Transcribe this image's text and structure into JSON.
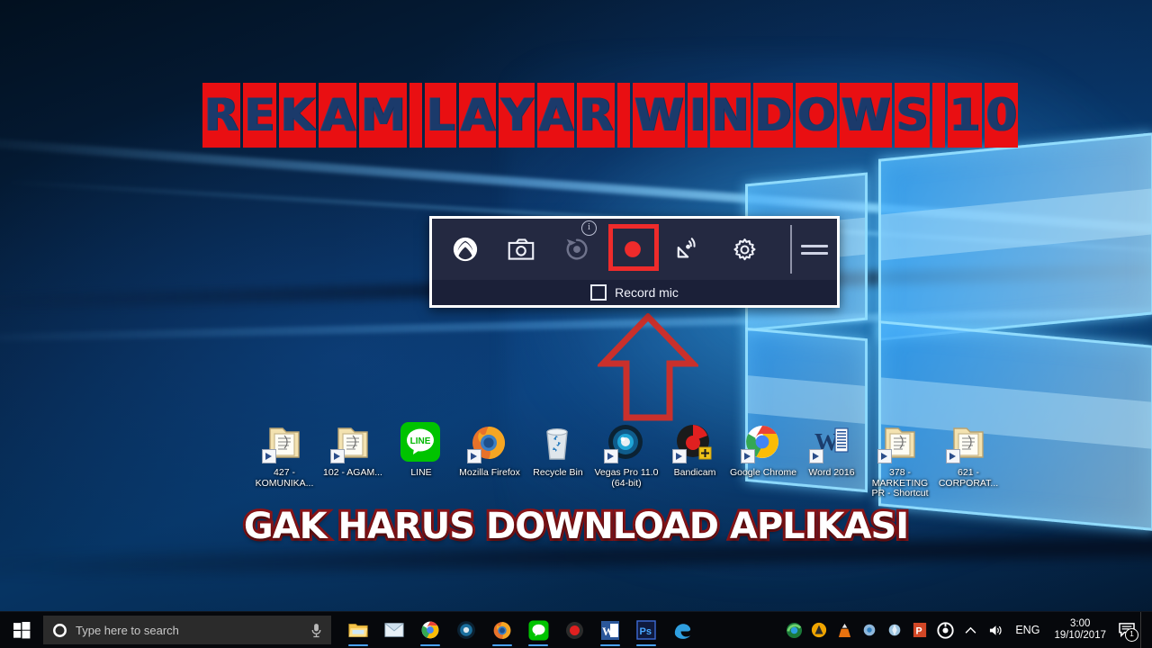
{
  "video_title": {
    "text": "REKAM LAYAR WINDOWS 10",
    "letters": [
      "R",
      "E",
      "K",
      "A",
      "M",
      " ",
      "L",
      "A",
      "Y",
      "A",
      "R",
      " ",
      "W",
      "I",
      "N",
      "D",
      "O",
      "W",
      "S",
      " ",
      "1",
      "0"
    ],
    "block_color": "#e90f12",
    "text_color": "#1b3a6b"
  },
  "caption": {
    "text": "GAK HARUS DOWNLOAD APLIKASI",
    "fill": "#ffffff",
    "outline": "#8b1418"
  },
  "game_bar": {
    "buttons": [
      {
        "name": "xbox-logo",
        "label": "Xbox",
        "state": "enabled"
      },
      {
        "name": "screenshot",
        "label": "Screenshot",
        "state": "enabled"
      },
      {
        "name": "record-last-30s",
        "label": "Record last 30 seconds",
        "state": "disabled",
        "badge": "i"
      },
      {
        "name": "start-recording",
        "label": "Start recording",
        "state": "highlighted",
        "highlight_color": "#ef2b2b"
      },
      {
        "name": "broadcast",
        "label": "Broadcast",
        "state": "enabled"
      },
      {
        "name": "settings",
        "label": "Settings",
        "state": "enabled"
      }
    ],
    "drag_handle": "drag-handle",
    "record_mic": {
      "label": "Record mic",
      "checked": false
    },
    "background": "#262a40",
    "border": "#ffffff"
  },
  "annotation": {
    "arrow": {
      "direction": "up",
      "color": "#c9302c",
      "points_to": "start-recording"
    }
  },
  "desktop_icons": [
    {
      "label": "427 - KOMUNIKA...",
      "type": "folder-shortcut"
    },
    {
      "label": "102 - AGAM...",
      "type": "folder-shortcut"
    },
    {
      "label": "LINE",
      "type": "app"
    },
    {
      "label": "Mozilla Firefox",
      "type": "app-shortcut"
    },
    {
      "label": "Recycle Bin",
      "type": "recycle-bin"
    },
    {
      "label": "Vegas Pro 11.0 (64-bit)",
      "type": "app-shortcut"
    },
    {
      "label": "Bandicam",
      "type": "app-shortcut"
    },
    {
      "label": "Google Chrome",
      "type": "app-shortcut"
    },
    {
      "label": "Word 2016",
      "type": "app-shortcut"
    },
    {
      "label": "378 - MARKETING PR - Shortcut",
      "type": "folder-shortcut"
    },
    {
      "label": "621 - CORPORAT...",
      "type": "folder-shortcut"
    }
  ],
  "taskbar": {
    "start_button": "start-button",
    "search": {
      "placeholder": "Type here to search",
      "cortana_icon": "cortana-ring",
      "mic_icon": "microphone-icon"
    },
    "pinned": [
      {
        "name": "file-explorer",
        "label": "File Explorer",
        "running": true
      },
      {
        "name": "mail",
        "label": "Mail",
        "running": false
      },
      {
        "name": "google-chrome",
        "label": "Google Chrome",
        "running": true
      },
      {
        "name": "vegas-pro",
        "label": "Vegas Pro",
        "running": false
      },
      {
        "name": "mozilla-firefox",
        "label": "Mozilla Firefox",
        "running": true
      },
      {
        "name": "line",
        "label": "LINE",
        "running": true
      },
      {
        "name": "bandicam",
        "label": "Bandicam",
        "running": false
      },
      {
        "name": "word",
        "label": "Word",
        "running": true
      },
      {
        "name": "photoshop",
        "label": "Photoshop",
        "running": true
      },
      {
        "name": "microsoft-edge",
        "label": "Microsoft Edge",
        "running": false
      }
    ],
    "tray": [
      {
        "name": "internet-download-manager",
        "label": "IDM"
      },
      {
        "name": "avast",
        "label": "Avast"
      },
      {
        "name": "vlc",
        "label": "VLC"
      },
      {
        "name": "tray-app-1",
        "label": "Tray app"
      },
      {
        "name": "tray-app-2",
        "label": "Tray app"
      },
      {
        "name": "powerpoint",
        "label": "PowerPoint"
      },
      {
        "name": "tray-app-3",
        "label": "Tray app"
      }
    ],
    "chevron": "show-hidden-icons",
    "volume": "speaker-icon",
    "language": "ENG",
    "time": "3:00",
    "date": "19/10/2017",
    "notifications": {
      "icon": "action-center-icon",
      "count": "1"
    }
  }
}
